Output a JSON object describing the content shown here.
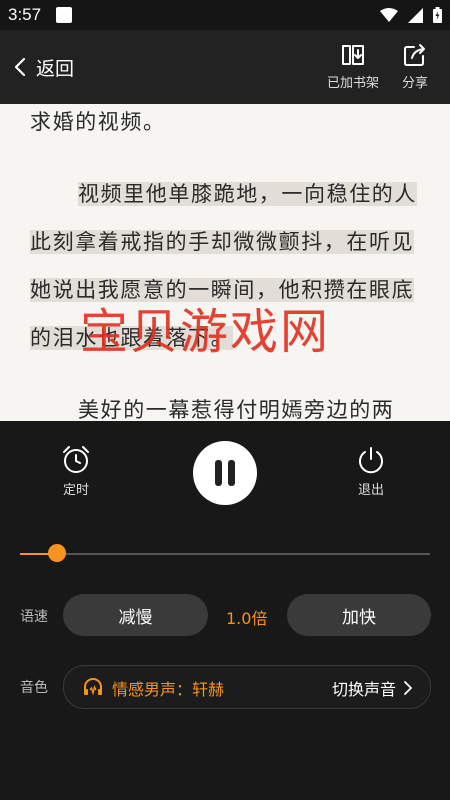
{
  "status_bar": {
    "time": "3:57"
  },
  "top_bar": {
    "back_label": "返回",
    "actions": [
      {
        "label": "已加书架",
        "icon": "bookshelf-add-icon"
      },
      {
        "label": "分享",
        "icon": "share-icon"
      }
    ]
  },
  "reader": {
    "paragraphs": [
      "求婚的视频。",
      "视频里他单膝跪地，一向稳住的人此刻拿着戒指的手却微微颤抖，在听见她说出我愿意的一瞬间，他积攒在眼底的泪水也跟着落下。",
      "美好的一幕惹得付明嫣旁边的两"
    ],
    "watermark": "宝贝游戏网"
  },
  "player": {
    "timer_label": "定时",
    "exit_label": "退出",
    "progress": 0.09,
    "speed": {
      "label": "语速",
      "slower": "减慢",
      "value": "1.0倍",
      "faster": "加快"
    },
    "voice": {
      "label": "音色",
      "current": "情感男声：轩赫",
      "switch": "切换声音"
    },
    "accent_color": "#f7931e"
  }
}
